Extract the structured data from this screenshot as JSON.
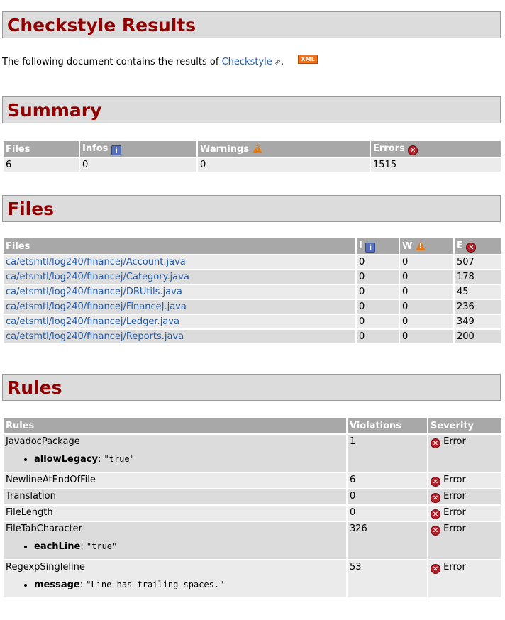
{
  "title": "Checkstyle Results",
  "intro": {
    "text": "The following document contains the results of",
    "link": "Checkstyle",
    "suffix": ".",
    "xml_badge": "XML"
  },
  "summary": {
    "heading": "Summary",
    "headers": {
      "files": "Files",
      "infos": "Infos",
      "warnings": "Warnings",
      "errors": "Errors"
    },
    "row": {
      "files": "6",
      "infos": "0",
      "warnings": "0",
      "errors": "1515"
    }
  },
  "files": {
    "heading": "Files",
    "headers": {
      "files": "Files",
      "i": "I",
      "w": "W",
      "e": "E"
    },
    "rows": [
      {
        "name": "ca/etsmtl/log240/financej/Account.java",
        "i": "0",
        "w": "0",
        "e": "507"
      },
      {
        "name": "ca/etsmtl/log240/financej/Category.java",
        "i": "0",
        "w": "0",
        "e": "178"
      },
      {
        "name": "ca/etsmtl/log240/financej/DBUtils.java",
        "i": "0",
        "w": "0",
        "e": "45"
      },
      {
        "name": "ca/etsmtl/log240/financej/FinanceJ.java",
        "i": "0",
        "w": "0",
        "e": "236"
      },
      {
        "name": "ca/etsmtl/log240/financej/Ledger.java",
        "i": "0",
        "w": "0",
        "e": "349"
      },
      {
        "name": "ca/etsmtl/log240/financej/Reports.java",
        "i": "0",
        "w": "0",
        "e": "200"
      }
    ]
  },
  "rules": {
    "heading": "Rules",
    "headers": {
      "rules": "Rules",
      "violations": "Violations",
      "severity": "Severity"
    },
    "rows": [
      {
        "name": "JavadocPackage",
        "prop_key": "allowLegacy",
        "prop_val": "\"true\"",
        "violations": "1",
        "severity": "Error"
      },
      {
        "name": "NewlineAtEndOfFile",
        "violations": "6",
        "severity": "Error"
      },
      {
        "name": "Translation",
        "violations": "0",
        "severity": "Error"
      },
      {
        "name": "FileLength",
        "violations": "0",
        "severity": "Error"
      },
      {
        "name": "FileTabCharacter",
        "prop_key": "eachLine",
        "prop_val": "\"true\"",
        "violations": "326",
        "severity": "Error"
      },
      {
        "name": "RegexpSingleline",
        "prop_key": "message",
        "prop_val": "\"Line has trailing spaces.\"",
        "violations": "53",
        "severity": "Error"
      }
    ]
  }
}
